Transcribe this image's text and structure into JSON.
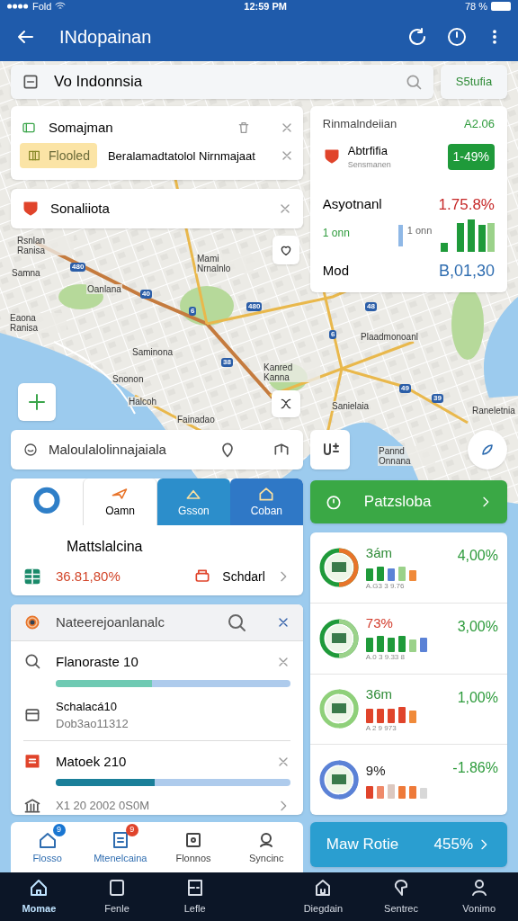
{
  "status_bar": {
    "carrier": "Fold",
    "time": "12:59 PM",
    "battery": "78 %"
  },
  "app_bar": {
    "title": "INdopainan"
  },
  "search": {
    "value": "Vo Indonnsia",
    "button": "S5tufia"
  },
  "route_card": {
    "title": "Somajman",
    "chip": "Flooled",
    "detail": "Beralamadtatolol Nirnmajaat"
  },
  "place_card": {
    "title": "Sonaliiota"
  },
  "stats_card": {
    "title": "Rinmalndeiian",
    "change": "A2.06",
    "item_title": "Abtrfifia",
    "item_subtitle": "Sensmanen",
    "badge": "1-49%",
    "metric_label": "Asyotnanl",
    "metric_value": "1.75.8%",
    "trend_label": "1 onn",
    "trend_caption": "1 onn",
    "total_label": "Mod",
    "total_value": "B,01,30"
  },
  "map": {
    "labels": [
      "Rsnlan Ranisa",
      "Samna",
      "Oanlana",
      "Eaona Ranisa",
      "Mami Nrnalnlo",
      "Saminona",
      "Snonon",
      "Halcoh",
      "Fainadao",
      "Kanred Kanna",
      "Plaadmonoanl",
      "Sanielaia",
      "Raneletnia",
      "Pannd Onnana"
    ],
    "shields": [
      "480",
      "40",
      "6",
      "480",
      "48",
      "6",
      "38",
      "49",
      "39"
    ]
  },
  "map_search": {
    "text": "Maloulalolinnajaiala"
  },
  "category_card": {
    "tabs": [
      {
        "label": "Oamn",
        "selected": true
      },
      {
        "label": "Gsson",
        "selected": false
      },
      {
        "label": "Coban",
        "selected": false
      }
    ],
    "title": "Mattslalcina",
    "amount": "36.81,80%",
    "action": "Schdarl"
  },
  "results": {
    "title": "Nateerejoanlanalc",
    "items": [
      {
        "kind": "bar",
        "title": "Flanoraste 10",
        "level": 0.41,
        "color": "#6fcab3"
      },
      {
        "kind": "text",
        "title": "Schalacá10",
        "subtitle": "Dob3ao11312"
      },
      {
        "kind": "bar",
        "title": "Matoek 210",
        "level": 0.42,
        "color": "#1a7f99"
      },
      {
        "kind": "link",
        "title": "X1 20 2002 0S0M"
      }
    ]
  },
  "trend_button": {
    "label": "Patzsloba"
  },
  "trends": [
    {
      "value": "3ám",
      "color": "#2e8b36",
      "ticks": "A.G3 3 9.76",
      "change": "4,00%"
    },
    {
      "value": "73%",
      "color": "#d23a2a",
      "ticks": "A.0 3 9.33 8",
      "change": "3,00%"
    },
    {
      "value": "36m",
      "color": "#2e8b36",
      "ticks": "A 2 9 973",
      "change": "1,00%"
    },
    {
      "value": "9%",
      "color": "#222222",
      "change": "-1.86%"
    }
  ],
  "quick_tabs": [
    {
      "label": "Flosso",
      "badge": {
        "text": "9",
        "color": "#1976d2"
      }
    },
    {
      "label": "Mtenelcaina",
      "badge": {
        "text": "9",
        "color": "#e0442b"
      }
    },
    {
      "label": "Flonnos"
    },
    {
      "label": "Syncinc"
    }
  ],
  "rate_button": {
    "label": "Maw Rotie",
    "value": "455%"
  },
  "bottom_nav": [
    {
      "label": "Momae",
      "selected": true
    },
    {
      "label": "Fenle",
      "selected": false
    },
    {
      "label": "Lefle",
      "selected": false
    },
    {
      "label": "Diegdain",
      "selected": false
    },
    {
      "label": "Sentrec",
      "selected": false
    },
    {
      "label": "Vonimo",
      "selected": false
    }
  ]
}
